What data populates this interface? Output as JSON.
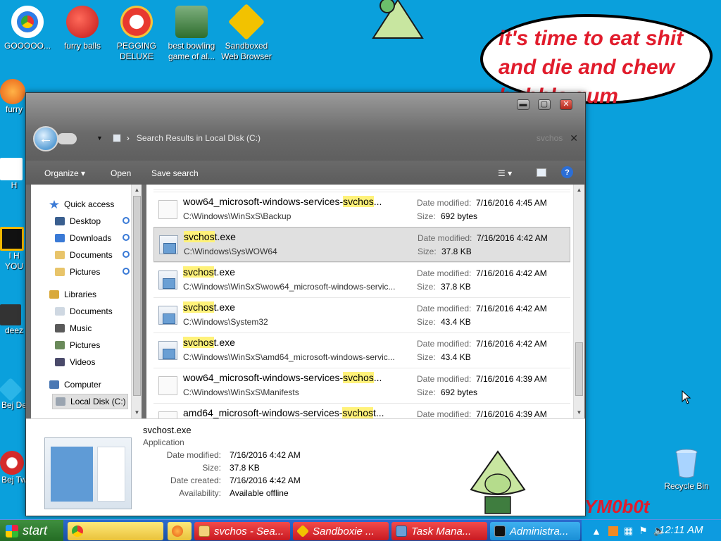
{
  "desktop": {
    "icons": [
      {
        "label": "GOOOOO...",
        "color": "#2b7de9"
      },
      {
        "label": "furry balls",
        "color": "#d22a2a"
      },
      {
        "label": "PEGGING DELUXE",
        "color": "#e8392f"
      },
      {
        "label": "best bowling game of al...",
        "color": "#3a8c3a"
      },
      {
        "label": "Sandboxed Web Browser",
        "color": "#f2c200"
      }
    ],
    "partial_icons": [
      "furry",
      "H",
      "I H YOU",
      "deez",
      "Bej De",
      "Bej Tw"
    ],
    "speech_bubble": "it's time to eat shit and die and chew bubble gum",
    "signature": "YM0b0t",
    "recycle_bin": "Recycle Bin"
  },
  "window": {
    "address": "Search Results in Local Disk (C:)",
    "search_value": "svchos",
    "toolbar": {
      "organize": "Organize",
      "open": "Open",
      "save_search": "Save search",
      "help": "?"
    },
    "nav": {
      "quick_access": "Quick access",
      "desktop": "Desktop",
      "downloads": "Downloads",
      "documents": "Documents",
      "pictures": "Pictures",
      "libraries": "Libraries",
      "lib_documents": "Documents",
      "music": "Music",
      "lib_pictures": "Pictures",
      "videos": "Videos",
      "computer": "Computer",
      "local_disk": "Local Disk (C:)"
    },
    "labels": {
      "date_modified": "Date modified:",
      "size": "Size:"
    },
    "results": [
      {
        "pre": "wow64_microsoft-windows-services-",
        "hl": "svchos",
        "post": "...",
        "path": "C:\\Windows\\WinSxS\\Backup",
        "date": "7/16/2016 4:45 AM",
        "size": "692 bytes",
        "icon": "doc"
      },
      {
        "pre": "",
        "hl": "svchos",
        "post": "t.exe",
        "path": "C:\\Windows\\SysWOW64",
        "date": "7/16/2016 4:42 AM",
        "size": "37.8 KB",
        "icon": "exe"
      },
      {
        "pre": "",
        "hl": "svchos",
        "post": "t.exe",
        "path": "C:\\Windows\\WinSxS\\wow64_microsoft-windows-servic...",
        "date": "7/16/2016 4:42 AM",
        "size": "37.8 KB",
        "icon": "exe"
      },
      {
        "pre": "",
        "hl": "svchos",
        "post": "t.exe",
        "path": "C:\\Windows\\System32",
        "date": "7/16/2016 4:42 AM",
        "size": "43.4 KB",
        "icon": "exe"
      },
      {
        "pre": "",
        "hl": "svchos",
        "post": "t.exe",
        "path": "C:\\Windows\\WinSxS\\amd64_microsoft-windows-servic...",
        "date": "7/16/2016 4:42 AM",
        "size": "43.4 KB",
        "icon": "exe"
      },
      {
        "pre": "wow64_microsoft-windows-services-",
        "hl": "svchos",
        "post": "...",
        "path": "C:\\Windows\\WinSxS\\Manifests",
        "date": "7/16/2016 4:39 AM",
        "size": "692 bytes",
        "icon": "doc"
      },
      {
        "pre": "amd64_microsoft-windows-services-",
        "hl": "svchos",
        "post": "t...",
        "path": "",
        "date": "7/16/2016 4:39 AM",
        "size": "",
        "icon": "doc"
      }
    ],
    "details": {
      "name": "svchost.exe",
      "type": "Application",
      "date_modified_label": "Date modified:",
      "date_modified": "7/16/2016 4:42 AM",
      "size_label": "Size:",
      "size": "37.8 KB",
      "date_created_label": "Date created:",
      "date_created": "7/16/2016 4:42 AM",
      "availability_label": "Availability:",
      "availability": "Available offline"
    }
  },
  "taskbar": {
    "start": "start",
    "tasks": [
      {
        "label": "svchos - Sea...",
        "color": "#d8262e"
      },
      {
        "label": "Sandboxie ...",
        "color": "#d8262e"
      },
      {
        "label": "Task Mana...",
        "color": "#d8262e"
      },
      {
        "label": "Administra...",
        "color": "#1b9be3"
      }
    ],
    "clock": "12:11 AM"
  }
}
